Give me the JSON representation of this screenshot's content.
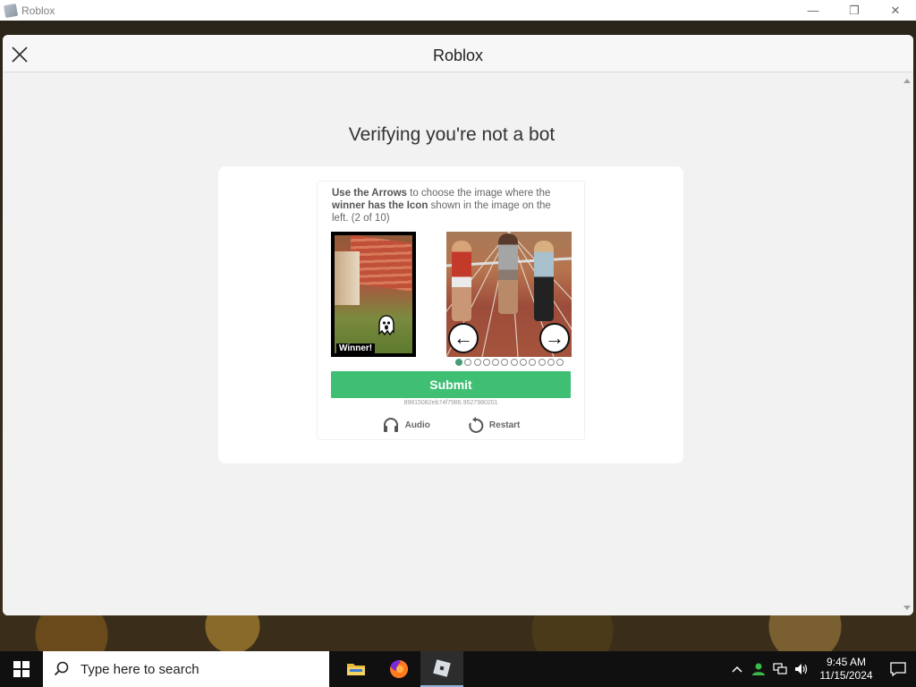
{
  "window": {
    "title": "Roblox",
    "minimize_glyph": "—",
    "restore_glyph": "❐",
    "close_glyph": "✕"
  },
  "modal": {
    "title": "Roblox",
    "heading": "Verifying you're not a bot"
  },
  "challenge": {
    "instr_part1_bold": "Use the Arrows",
    "instr_part2": " to choose the image where the ",
    "instr_part3_bold": "winner has the Icon",
    "instr_part4": " shown in the image on the left. (2 of 10)",
    "winner_label": "Winner!",
    "left_arrow": "←",
    "right_arrow": "→",
    "pagination": {
      "total": 12,
      "current": 1
    },
    "submit_label": "Submit",
    "session_id": "89815082eb74f7986.9527980201",
    "audio_label": "Audio",
    "restart_label": "Restart"
  },
  "taskbar": {
    "search_placeholder": "Type here to search",
    "apps": [
      "file-explorer",
      "firefox",
      "roblox"
    ],
    "time": "9:45 AM",
    "date": "11/15/2024"
  },
  "colors": {
    "submit": "#3fbf74",
    "active_dot": "#4a9a78"
  }
}
